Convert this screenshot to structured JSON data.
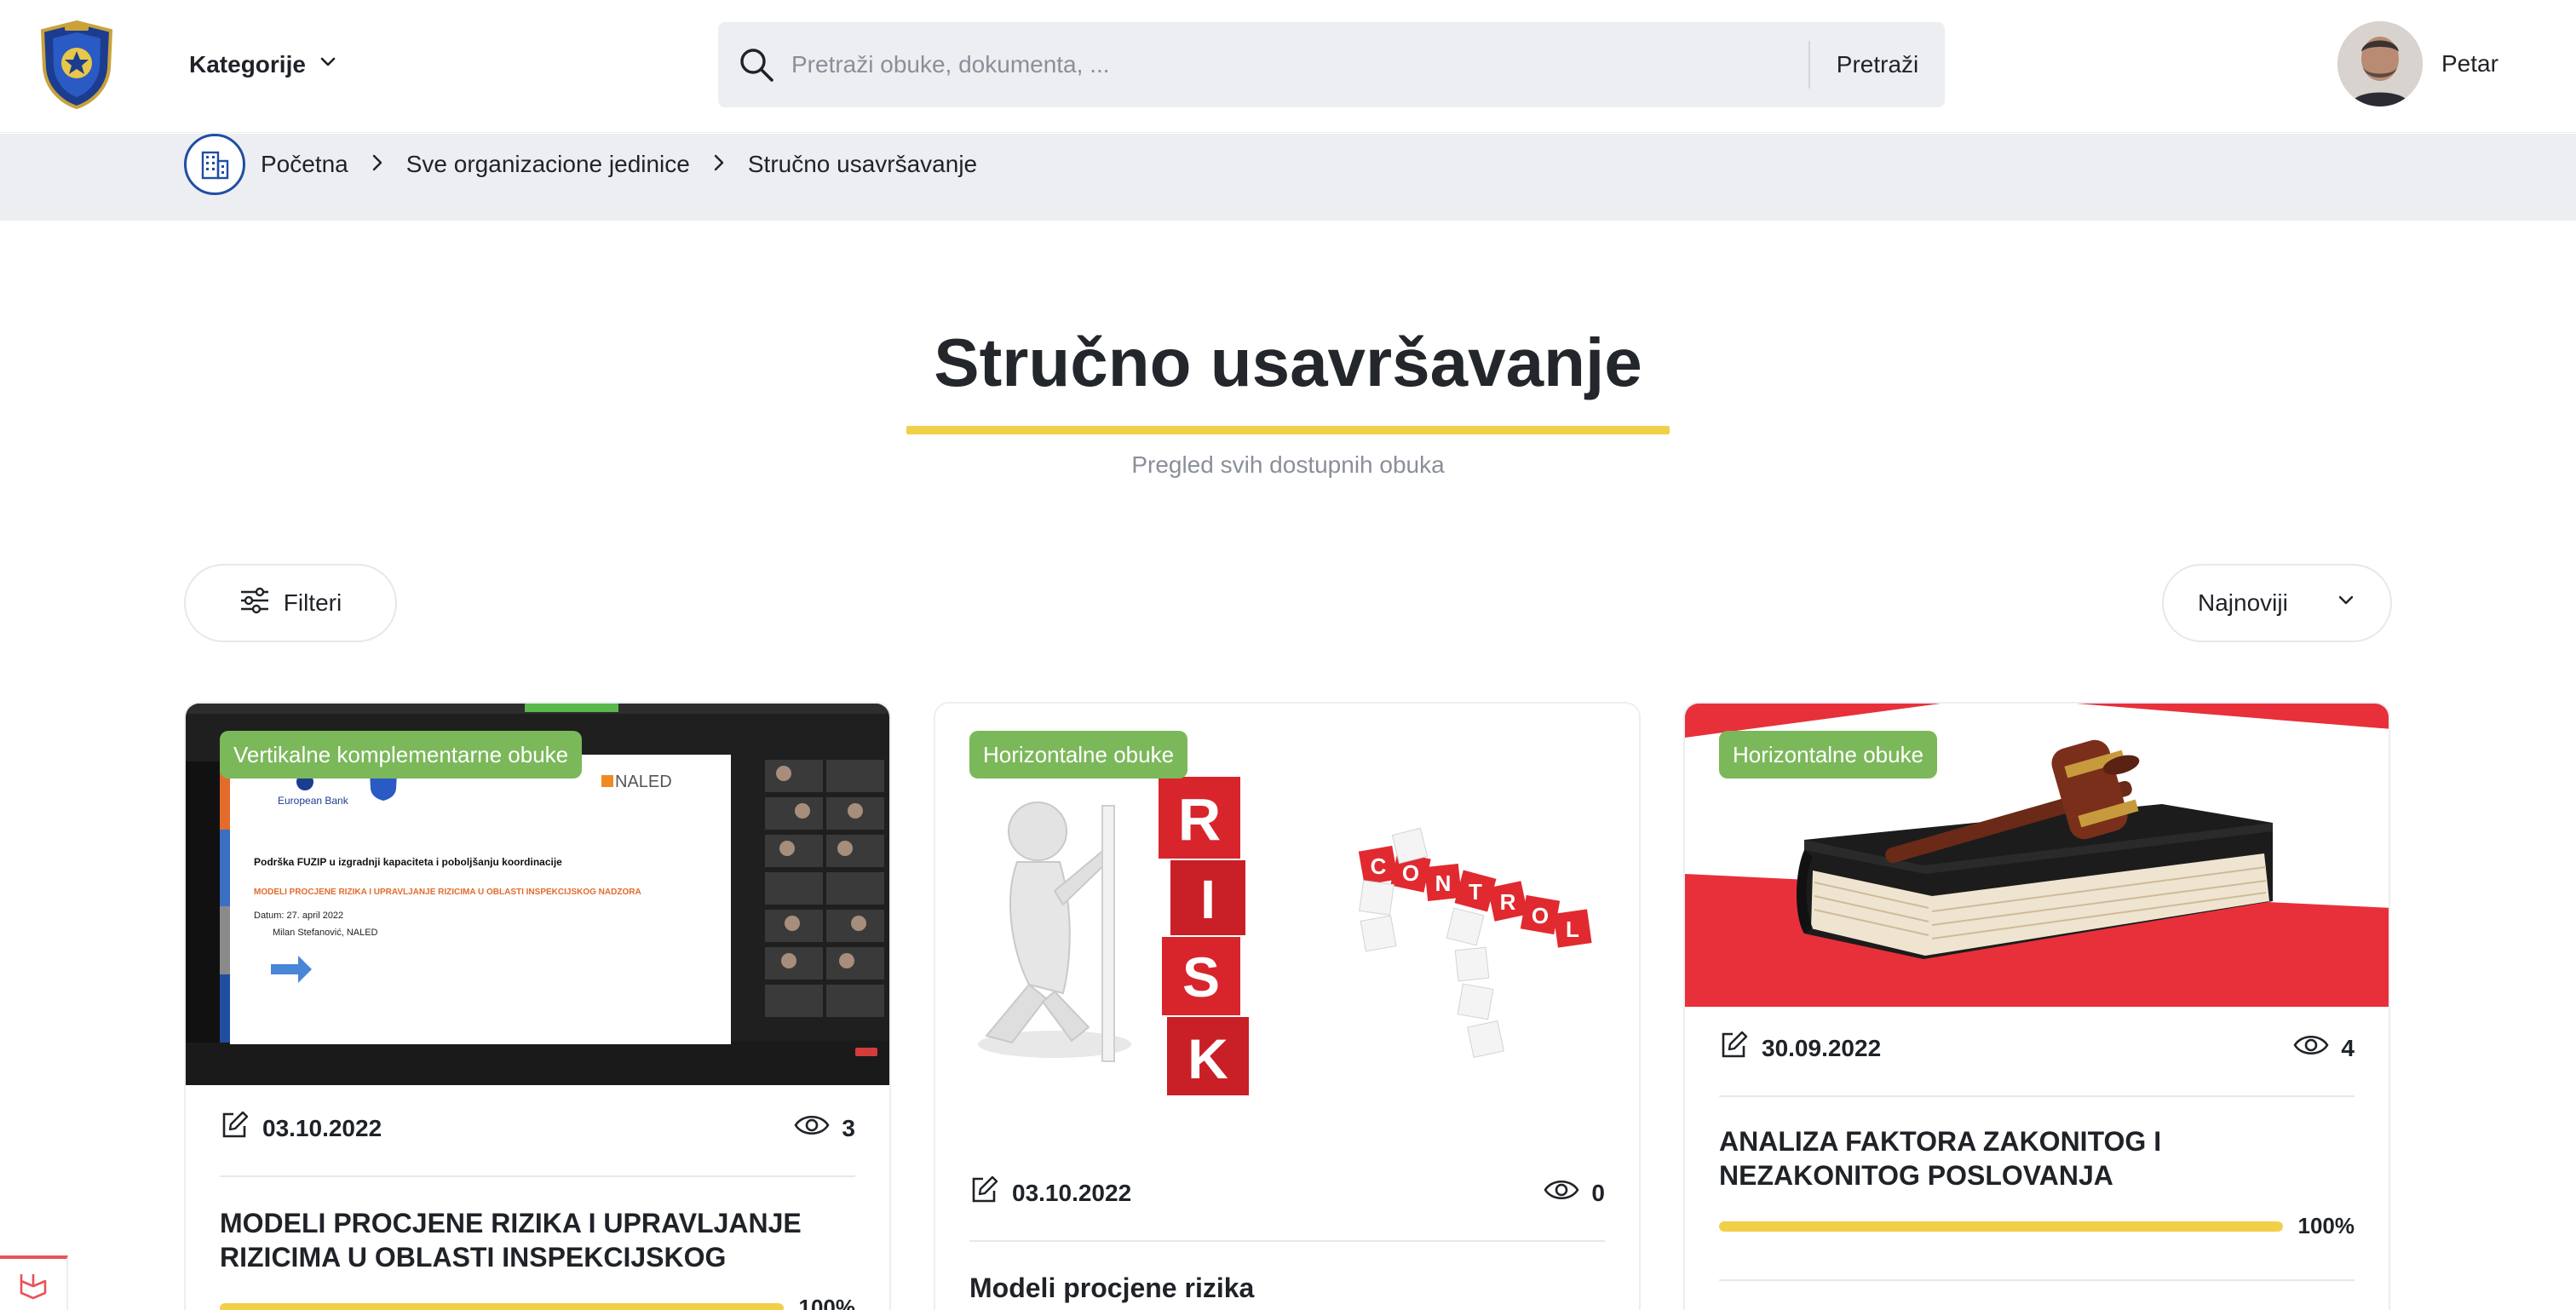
{
  "header": {
    "categories_label": "Kategorije",
    "search_placeholder": "Pretraži obuke, dokumenta, ...",
    "search_button": "Pretraži",
    "user_name": "Petar"
  },
  "breadcrumb": {
    "items": [
      "Početna",
      "Sve organizacione jedinice",
      "Stručno usavršavanje"
    ]
  },
  "page": {
    "title": "Stručno usavršavanje",
    "subtitle": "Pregled svih dostupnih obuka"
  },
  "toolbar": {
    "filter_label": "Filteri",
    "sort_value": "Najnoviji"
  },
  "cards": [
    {
      "badge": "Vertikalne komplementarne obuke",
      "date": "03.10.2022",
      "views": "3",
      "title": "MODELI PROCJENE RIZIKA I UPRAVLJANJE RIZICIMA U OBLASTI INSPEKCIJSKOG",
      "progress_percent": 100,
      "progress_label": "100%"
    },
    {
      "badge": "Horizontalne obuke",
      "date": "03.10.2022",
      "views": "0",
      "title": "Modeli procjene rizika"
    },
    {
      "badge": "Horizontalne obuke",
      "date": "30.09.2022",
      "views": "4",
      "title": "ANALIZA FAKTORA ZAKONITOG I NEZAKONITOG POSLOVANJA",
      "progress_percent": 100,
      "progress_label": "100%"
    }
  ],
  "slide": {
    "bank": "European Bank",
    "naled": "NALED",
    "line1": "Podrška FUZIP u izgradnji kapaciteta i poboljšanju koordinacije",
    "line2": "MODELI PROCJENE RIZIKA I UPRAVLJANJE RIZICIMA U OBLASTI INSPEKCIJSKOG NADZORA",
    "line3": "Datum: 27. april 2022",
    "line4": "Milan Stefanović, NALED"
  },
  "risk_image": {
    "risk_letters": [
      "R",
      "I",
      "S",
      "K"
    ],
    "control_letters": [
      "C",
      "O",
      "N",
      "T",
      "R",
      "O",
      "L"
    ]
  },
  "colors": {
    "accent_yellow": "#f1cf47",
    "badge_green": "#7bb85a",
    "breadcrumb_bg": "#eceef1",
    "home_blue": "#1f4ea3",
    "brand_red": "#e8303a"
  }
}
